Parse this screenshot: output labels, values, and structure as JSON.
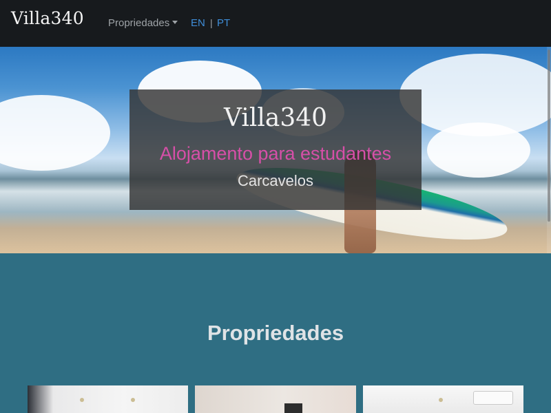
{
  "navbar": {
    "brand": "Villa340",
    "properties_menu": "Propriedades",
    "lang_en": "EN",
    "lang_separator": "|",
    "lang_pt": "PT"
  },
  "hero": {
    "title": "Villa340",
    "subtitle": "Alojamento para estudantes",
    "location": "Carcavelos"
  },
  "properties": {
    "heading": "Propriedades"
  },
  "icons": {
    "dropdown": "chevron-down-icon"
  },
  "colors": {
    "navbar_bg": "#171a1d",
    "page_bg": "#2f6e83",
    "accent_pink": "#d64fa8",
    "link_blue": "#3f8ed9"
  }
}
